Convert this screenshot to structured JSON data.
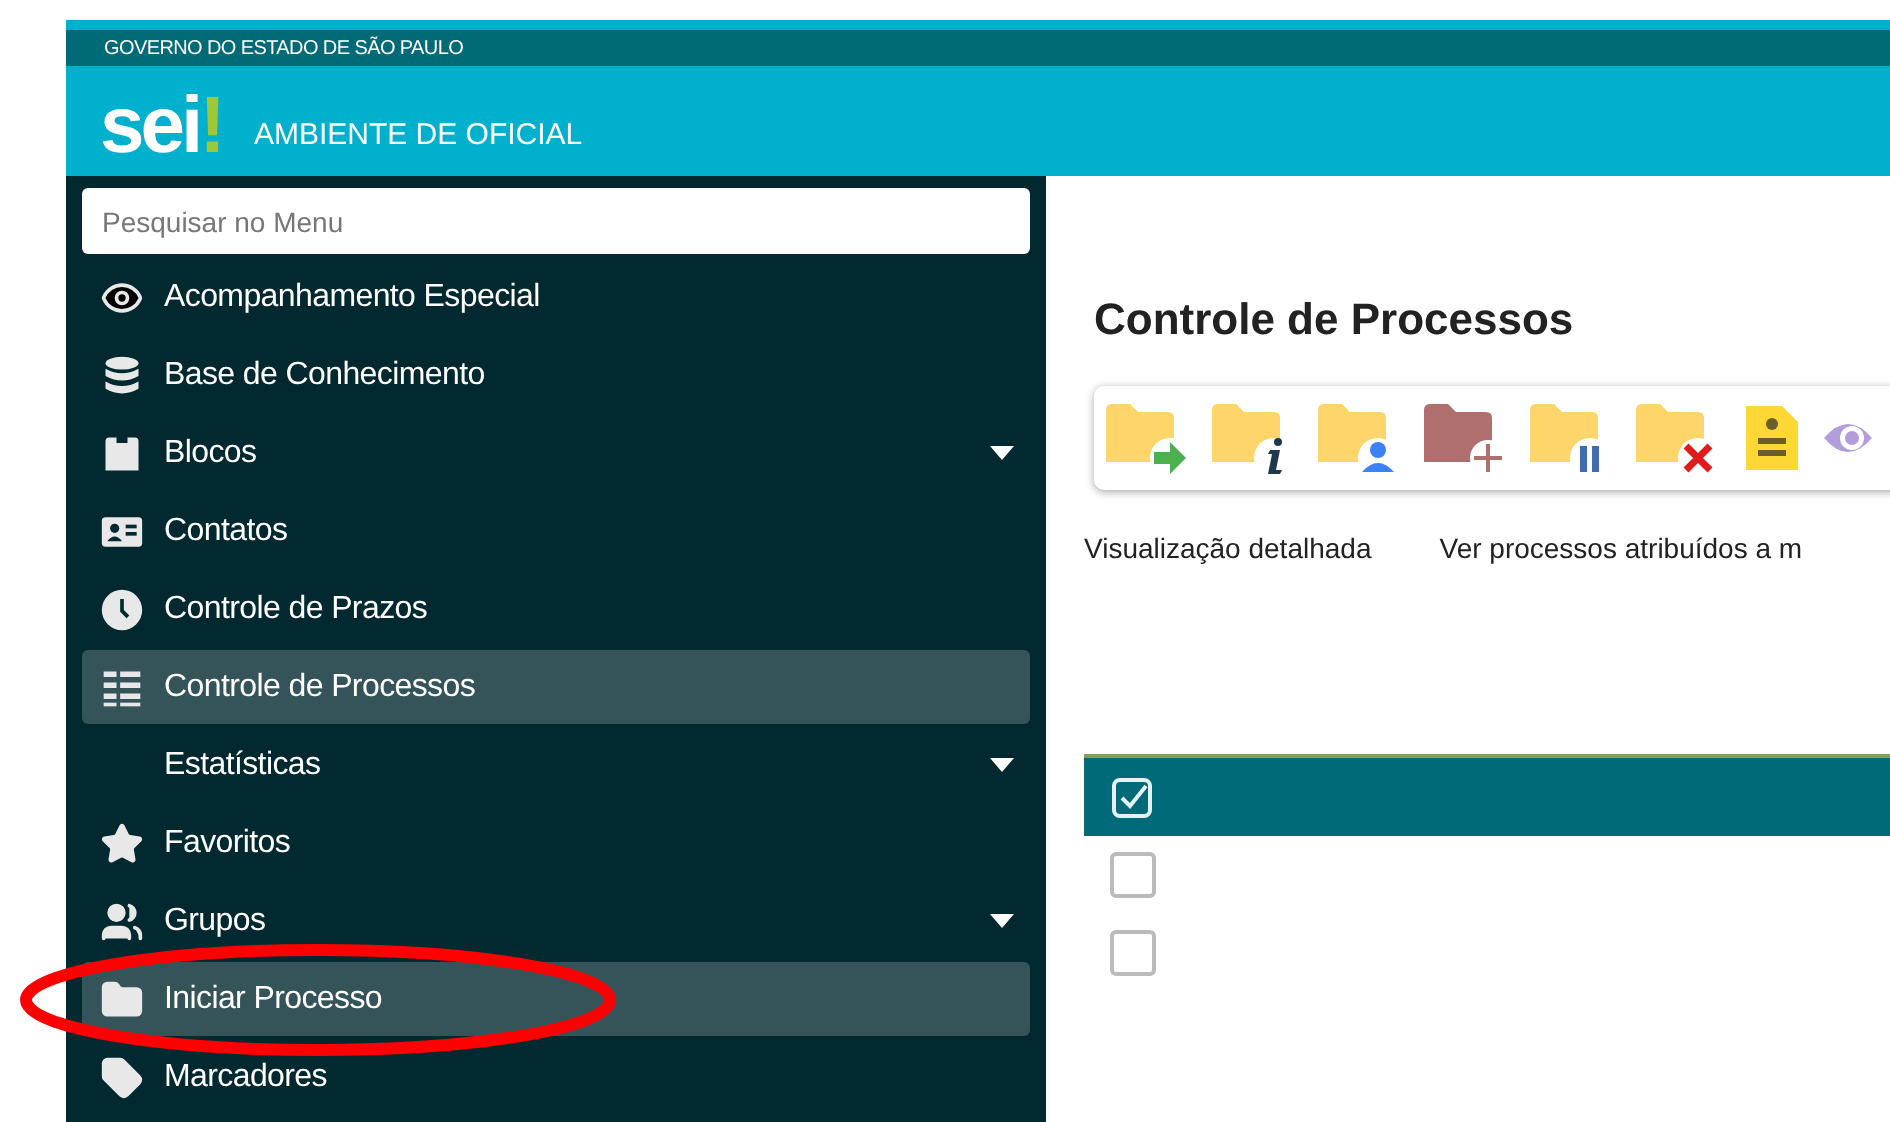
{
  "header": {
    "government": "GOVERNO DO ESTADO DE SÃO PAULO",
    "logo": "sei",
    "logo_mark": "!",
    "environment": "AMBIENTE DE OFICIAL"
  },
  "sidebar": {
    "search": {
      "placeholder": "Pesquisar no Menu"
    },
    "items": [
      {
        "label": "Acompanhamento Especial",
        "selected": false,
        "expandable": false
      },
      {
        "label": "Base de Conhecimento",
        "selected": false,
        "expandable": false
      },
      {
        "label": "Blocos",
        "selected": false,
        "expandable": true
      },
      {
        "label": "Contatos",
        "selected": false,
        "expandable": false
      },
      {
        "label": "Controle de Prazos",
        "selected": false,
        "expandable": false
      },
      {
        "label": "Controle de Processos",
        "selected": true,
        "expandable": false
      },
      {
        "label": "Estatísticas",
        "selected": false,
        "expandable": true
      },
      {
        "label": "Favoritos",
        "selected": false,
        "expandable": false
      },
      {
        "label": "Grupos",
        "selected": false,
        "expandable": true
      },
      {
        "label": "Iniciar Processo",
        "selected": true,
        "expandable": false
      },
      {
        "label": "Marcadores",
        "selected": false,
        "expandable": false
      }
    ]
  },
  "main": {
    "title": "Controle de Processos",
    "view_links": [
      "Visualização detalhada",
      "Ver processos atribuídos a m"
    ],
    "table": {
      "header_checked": true,
      "rows": [
        {
          "checked": false
        },
        {
          "checked": false
        }
      ]
    }
  }
}
